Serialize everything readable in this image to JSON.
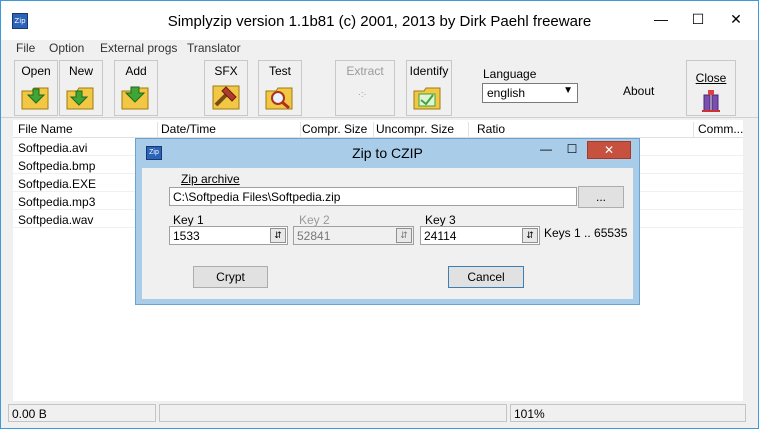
{
  "window": {
    "title": "Simplyzip version 1.1b81 (c) 2001, 2013 by Dirk Paehl freeware",
    "app_icon": "Zip"
  },
  "window_controls": {
    "minimize": "—",
    "maximize": "☐",
    "close": "✕"
  },
  "menu": [
    "File",
    "Option",
    "External progs",
    "Translator"
  ],
  "toolbar": {
    "open_label": "Open",
    "new_label": "New",
    "add_label": "Add",
    "sfx_label": "SFX",
    "test_label": "Test",
    "extract_label": "Extract",
    "identify_label": "Identify",
    "language_label": "Language",
    "language_value": "english",
    "about_label": "About",
    "close_label": "Close"
  },
  "columns": [
    "File Name",
    "Date/Time",
    "Compr. Size",
    "Uncompr. Size",
    "Ratio",
    "Comm..."
  ],
  "files": [
    "Softpedia.avi",
    "Softpedia.bmp",
    "Softpedia.EXE",
    "Softpedia.mp3",
    "Softpedia.wav"
  ],
  "status": {
    "size": "0.00 B",
    "middle": "",
    "ratio": "101%"
  },
  "dialog": {
    "title": "Zip to CZIP",
    "icon": "Zip",
    "close_symbol": "✕",
    "archive_label": "Zip archive",
    "archive_value": "C:\\Softpedia Files\\Softpedia.zip",
    "browse_label": "...",
    "key1_label": "Key 1",
    "key1_value": "1533",
    "key2_label": "Key 2",
    "key2_value": "52841",
    "key3_label": "Key 3",
    "key3_value": "24114",
    "keys_range": "Keys 1 .. 65535",
    "crypt_label": "Crypt",
    "cancel_label": "Cancel"
  },
  "colors": {
    "accent": "#3c9ad8",
    "dialog_frame": "#a9cde9",
    "close_red": "#c7513f",
    "folder_yellow": "#f2c744",
    "arrow_green": "#3fa535"
  }
}
